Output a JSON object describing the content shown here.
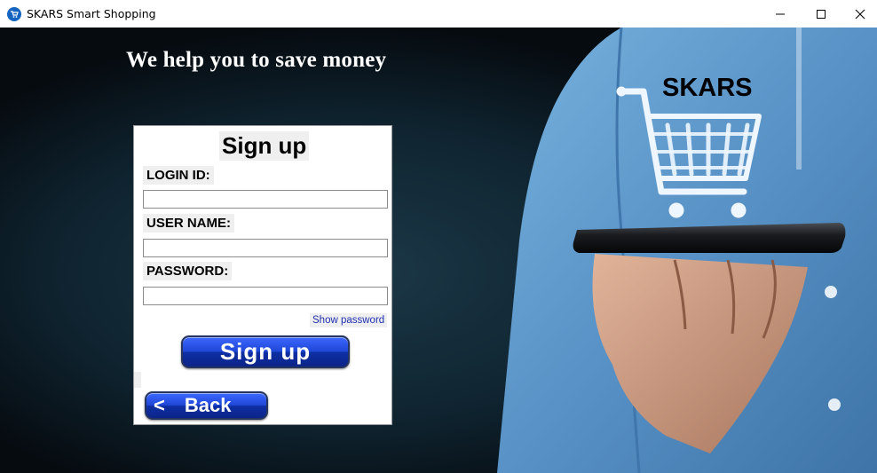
{
  "window": {
    "title": "SKARS Smart Shopping",
    "controls": {
      "minimize": "—",
      "maximize": "☐",
      "close": "✕"
    }
  },
  "banner": {
    "headline": "We help you to save money",
    "brand": "SKARS"
  },
  "form": {
    "title": "Sign up",
    "login_id": {
      "label": "LOGIN ID:",
      "value": "",
      "placeholder": ""
    },
    "user_name": {
      "label": "USER NAME:",
      "value": "",
      "placeholder": ""
    },
    "password": {
      "label": "PASSWORD:",
      "value": "",
      "placeholder": ""
    },
    "show_password_label": "Show password",
    "signup_label": "Sign up",
    "back_label": "Back",
    "back_arrow": "<"
  },
  "colors": {
    "background": "#0a1218",
    "shirt": "#5d98c8",
    "button": "#1f48d7",
    "link": "#1f2fb0"
  },
  "icons": [
    "app-icon",
    "shopping-cart-icon",
    "smartphone-image"
  ]
}
